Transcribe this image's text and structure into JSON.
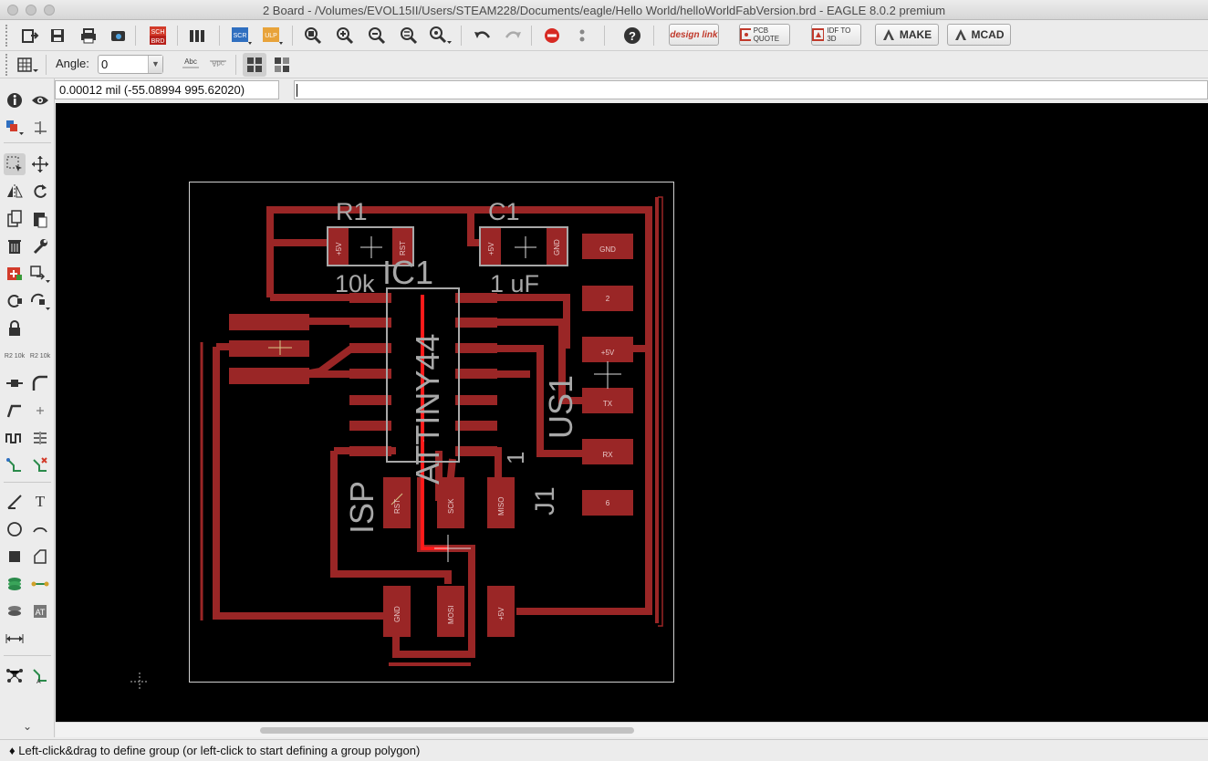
{
  "window": {
    "title": "2 Board - /Volumes/EVOL15II/Users/STEAM228/Documents/eagle/Hello World/helloWorldFabVersion.brd - EAGLE 8.0.2 premium"
  },
  "toolbar": {
    "sch_brd_label": "SCH BRD",
    "scr_label": "SCR",
    "ulp_label": "ULP",
    "design_link_label": "design link",
    "pcb_quote_label": "PCB QUOTE",
    "idf_label": "IDF TO 3D",
    "make_label": "MAKE",
    "mcad_label": "MCAD"
  },
  "param_bar": {
    "angle_label": "Angle:",
    "angle_value": "0",
    "text_btn1": "Abc",
    "text_btn2": "Abc"
  },
  "coordinate_display": "0.00012 mil (-55.08994 995.62020)",
  "command_line": "",
  "sidebar": {
    "r2_label_a": "R2 10k",
    "r2_label_b": "R2 10k"
  },
  "board": {
    "components": {
      "r1_name": "R1",
      "r1_value": "10k",
      "c1_name": "C1",
      "c1_value": "1 uF",
      "ic1_name": "IC1",
      "ic1_value": "ATTINY44",
      "us1_name": "US1",
      "isp_name": "ISP",
      "j1_name": "J1",
      "j1_pin_one": "1"
    },
    "pads": {
      "r1_p1": "+5V",
      "r1_p2": "RST",
      "c1_p1": "+5V",
      "c1_p2": "GND",
      "us1_1": "GND",
      "us1_2": "2",
      "us1_3": "+5V",
      "us1_4": "TX",
      "us1_5": "RX",
      "us1_6": "6",
      "isp_rst": "RST",
      "isp_sck": "SCK",
      "isp_miso": "MISO",
      "isp_gnd": "GND",
      "isp_mosi": "MOSI",
      "isp_5v": "+5V"
    },
    "colors": {
      "copper": "#9a2626",
      "highlight": "#ff0000",
      "silk": "#a8a8a8",
      "background": "#000000"
    }
  },
  "status_text": "♦ Left-click&drag to define group (or left-click to start defining a group polygon)"
}
